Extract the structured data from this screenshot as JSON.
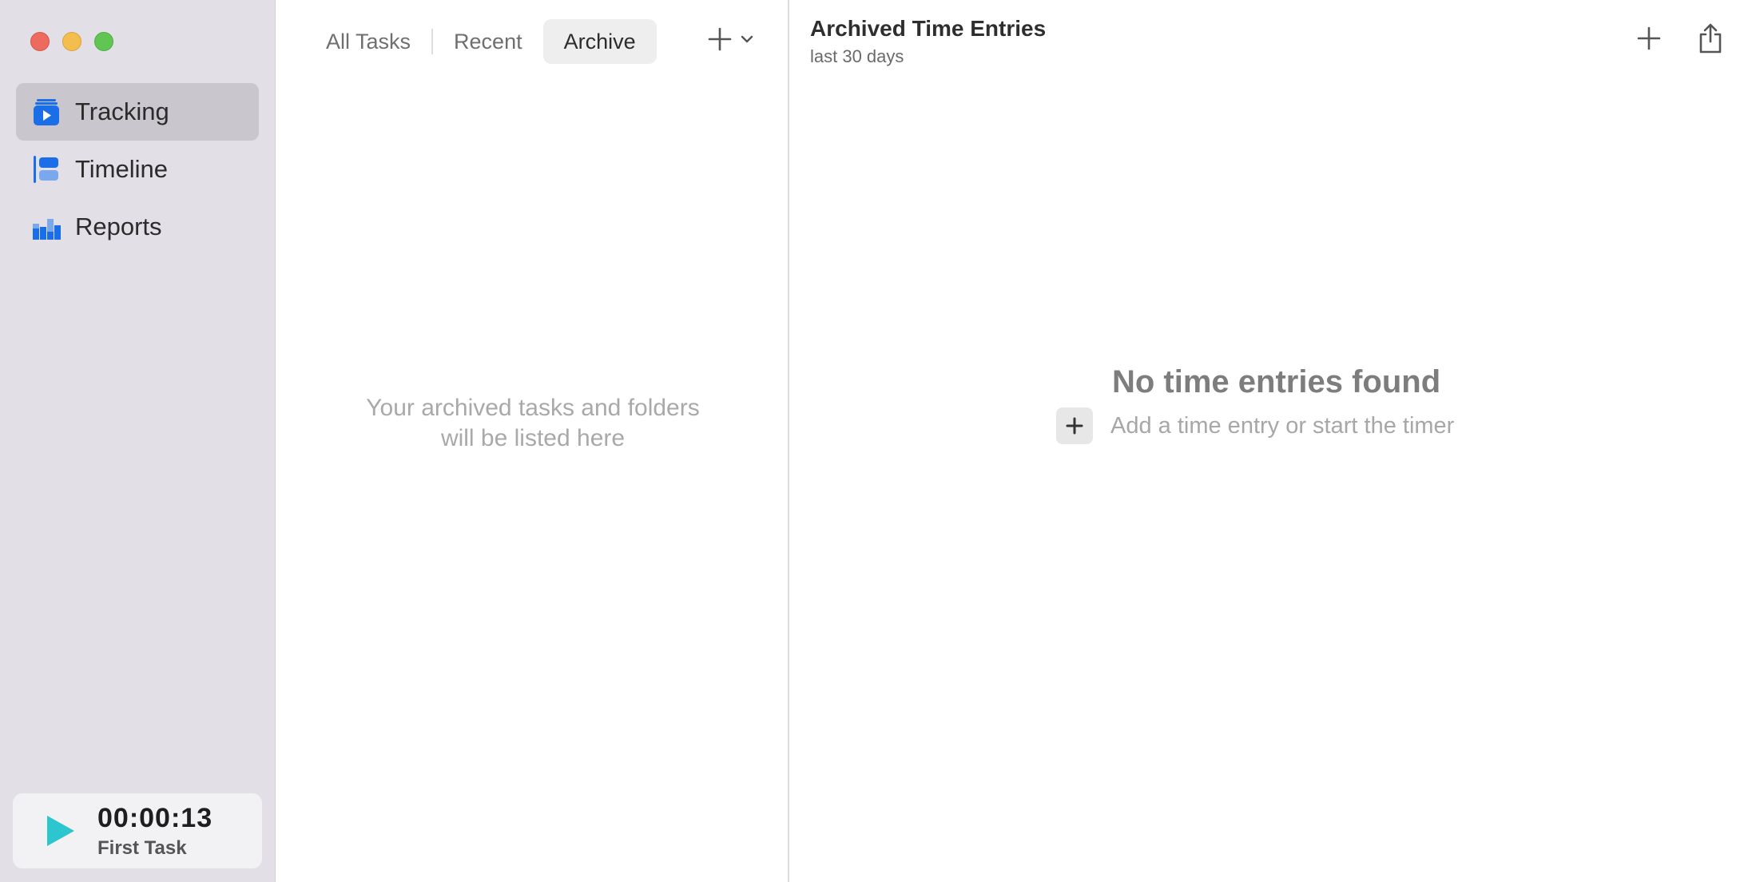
{
  "sidebar": {
    "items": [
      {
        "label": "Tracking",
        "icon": "tracking-icon",
        "selected": true
      },
      {
        "label": "Timeline",
        "icon": "timeline-icon",
        "selected": false
      },
      {
        "label": "Reports",
        "icon": "reports-icon",
        "selected": false
      }
    ],
    "timer": {
      "time": "00:00:13",
      "task": "First Task",
      "icon": "play-icon"
    }
  },
  "middle": {
    "tabs": [
      {
        "label": "All Tasks",
        "active": false
      },
      {
        "label": "Recent",
        "active": false
      },
      {
        "label": "Archive",
        "active": true
      }
    ],
    "empty_line1": "Your archived tasks and folders",
    "empty_line2": "will be listed here"
  },
  "detail": {
    "title": "Archived Time Entries",
    "subtitle": "last 30 days",
    "empty_title": "No time entries found",
    "empty_hint": "Add a time entry or start the timer"
  },
  "colors": {
    "accent": "#1a6fe8",
    "accent_light": "#7aa8ef",
    "play": "#2cc6cf",
    "sidebar_bg": "#e2dfe6"
  }
}
